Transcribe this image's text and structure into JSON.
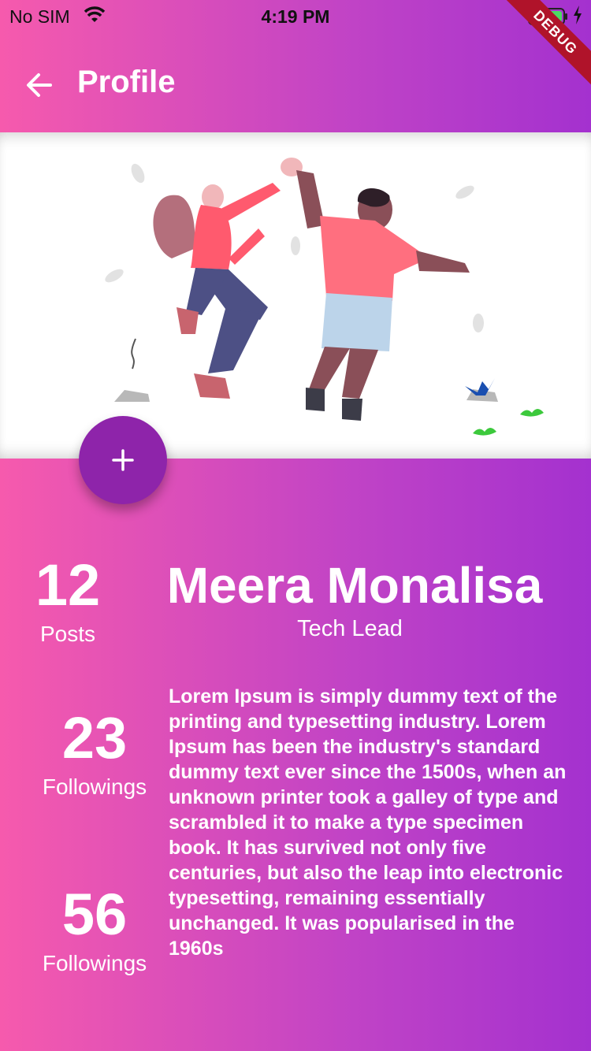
{
  "status_bar": {
    "carrier": "No SIM",
    "time": "4:19 PM"
  },
  "debug_banner": "DEBUG",
  "app_bar": {
    "title": "Profile",
    "back_icon": "arrow-back-icon"
  },
  "fab": {
    "icon": "plus-icon"
  },
  "stats": [
    {
      "value": "12",
      "label": "Posts"
    },
    {
      "value": "23",
      "label": "Followings"
    },
    {
      "value": "56",
      "label": "Followings"
    }
  ],
  "profile": {
    "name": "Meera Monalisa",
    "role": "Tech Lead",
    "bio": "Lorem Ipsum is simply dummy text of the printing and typesetting industry. Lorem Ipsum has been the industry's standard dummy text ever since the 1500s, when an unknown printer took a galley of type and scrambled it to make a type specimen book. It has survived not only five centuries, but also the leap into electronic typesetting, remaining essentially unchanged. It was popularised in the 1960s"
  },
  "colors": {
    "gradient_start": "#f65aad",
    "gradient_end": "#a431cf",
    "fab": "#8e24aa",
    "debug_ribbon": "#b0132a"
  }
}
